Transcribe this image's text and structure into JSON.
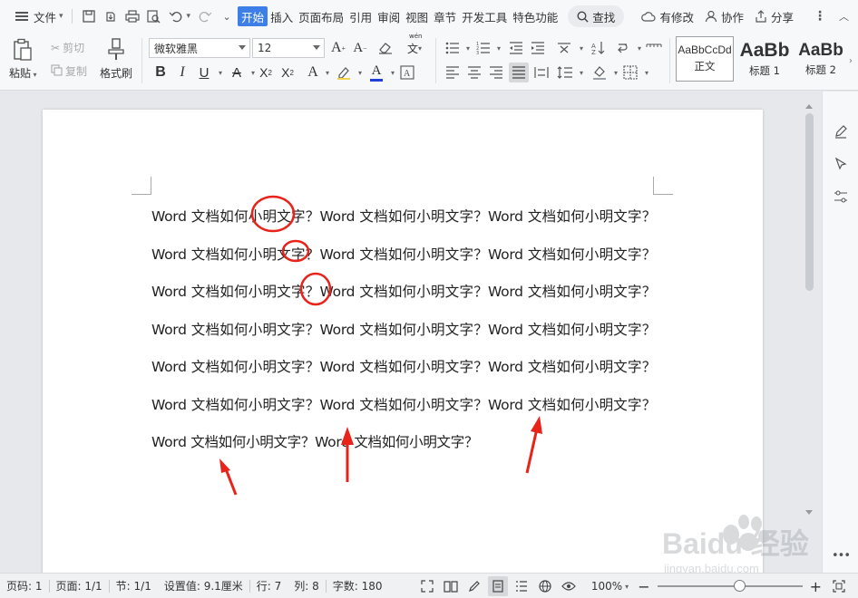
{
  "menubar": {
    "file_label": "文件",
    "tabs": [
      "开始",
      "插入",
      "页面布局",
      "引用",
      "审阅",
      "视图",
      "章节",
      "开发工具",
      "特色功能"
    ],
    "active_tab": "开始",
    "search_label": "查找",
    "actions": {
      "changes": "有修改",
      "collaborate": "协作",
      "share": "分享"
    }
  },
  "ribbon": {
    "paste": "粘贴",
    "cut": "剪切",
    "copy": "复制",
    "format_painter": "格式刷",
    "font_name": "微软雅黑",
    "font_size": "12",
    "styles": [
      {
        "sample": "AaBbCcDd",
        "label": "正文"
      },
      {
        "sample": "AaBb",
        "label": "标题 1"
      },
      {
        "sample": "AaBb",
        "label": "标题 2"
      }
    ]
  },
  "document": {
    "body": "Word 文档如何小明文字？Word 文档如何小明文字？Word 文档如何小明文字？Word 文档如何小明文字？Word 文档如何小明文字？Word 文档如何小明文字？Word 文档如何小明文字？Word 文档如何小明文字？Word 文档如何小明文字？Word 文档如何小明文字？Word 文档如何小明文字？Word 文档如何小明文字？Word 文档如何小明文字？Word 文档如何小明文字？Word 文档如何小明文字？Word 文档如何小明文字？Word 文档如何小明文字？Word 文档如何小明文字？Word 文档如何小明文字？Word 文档如何小明文字？"
  },
  "statusbar": {
    "page_num": "页码: 1",
    "pages": "页面: 1/1",
    "section": "节: 1/1",
    "setting": "设置值: 9.1厘米",
    "row": "行: 7",
    "col": "列: 8",
    "word_count": "字数: 180",
    "zoom": "100%"
  },
  "annotation_color": "#e8231a",
  "accent_color": "#3d7fe6",
  "watermark_text": "Baidu 经验",
  "watermark_sub": "jingyan.baidu.com"
}
